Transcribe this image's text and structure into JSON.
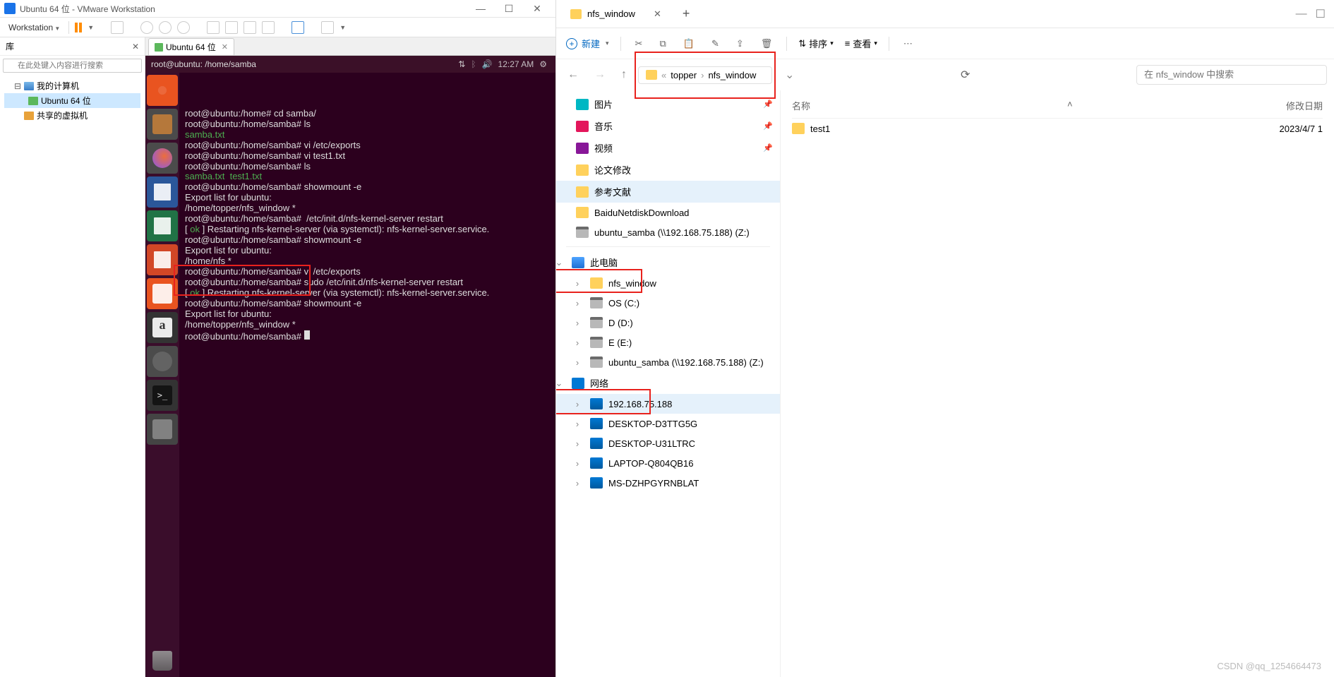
{
  "vmware": {
    "title": "Ubuntu 64 位 - VMware Workstation",
    "menu": "Workstation",
    "library": {
      "title": "库",
      "search_placeholder": "在此处键入内容进行搜索"
    },
    "tree": {
      "my_computer": "我的计算机",
      "ubuntu": "Ubuntu 64 位",
      "shared": "共享的虚拟机"
    },
    "tab": "Ubuntu 64 位"
  },
  "ubuntu": {
    "title": "root@ubuntu: /home/samba",
    "time": "12:27 AM",
    "terminal": [
      {
        "t": "",
        "cls": ""
      },
      {
        "t": "root@ubuntu:/home# cd samba/",
        "cls": ""
      },
      {
        "t": "root@ubuntu:/home/samba# ls",
        "cls": ""
      },
      {
        "t": "samba.txt",
        "cls": "file"
      },
      {
        "t": "root@ubuntu:/home/samba# vi /etc/exports",
        "cls": ""
      },
      {
        "t": "root@ubuntu:/home/samba# vi test1.txt",
        "cls": ""
      },
      {
        "t": "root@ubuntu:/home/samba# ls",
        "cls": ""
      },
      {
        "t": "samba.txt  test1.txt",
        "cls": "file"
      },
      {
        "t": "root@ubuntu:/home/samba# showmount -e",
        "cls": ""
      },
      {
        "t": "Export list for ubuntu:",
        "cls": ""
      },
      {
        "t": "/home/topper/nfs_window *",
        "cls": ""
      },
      {
        "t": "root@ubuntu:/home/samba#  /etc/init.d/nfs-kernel-server restart",
        "cls": ""
      },
      {
        "t": "[ ok ] Restarting nfs-kernel-server (via systemctl): nfs-kernel-server.service.",
        "cls": "ok-line"
      },
      {
        "t": "root@ubuntu:/home/samba# showmount -e",
        "cls": ""
      },
      {
        "t": "Export list for ubuntu:",
        "cls": ""
      },
      {
        "t": "/home/nfs *",
        "cls": ""
      },
      {
        "t": "root@ubuntu:/home/samba# vi /etc/exports",
        "cls": ""
      },
      {
        "t": "root@ubuntu:/home/samba# sudo /etc/init.d/nfs-kernel-server restart",
        "cls": ""
      },
      {
        "t": "[ ok ] Restarting nfs-kernel-server (via systemctl): nfs-kernel-server.service.",
        "cls": "ok-line"
      },
      {
        "t": "root@ubuntu:/home/samba# showmount -e",
        "cls": ""
      },
      {
        "t": "Export list for ubuntu:",
        "cls": ""
      },
      {
        "t": "/home/topper/nfs_window *",
        "cls": ""
      },
      {
        "t": "root@ubuntu:/home/samba# ",
        "cls": "prompt"
      }
    ]
  },
  "explorer": {
    "tab": "nfs_window",
    "new": "新建",
    "sort": "排序",
    "view": "查看",
    "breadcrumb": {
      "chev": "«",
      "p1": "topper",
      "p2": "nfs_window"
    },
    "search_placeholder": "在 nfs_window 中搜索",
    "nav": {
      "pictures": "图片",
      "music": "音乐",
      "video": "视频",
      "paper_edit": "论文修改",
      "references": "参考文献",
      "baidu": "BaiduNetdiskDownload",
      "samba": "ubuntu_samba (\\\\192.168.75.188) (Z:)",
      "this_pc": "此电脑",
      "nfs_window": "nfs_window",
      "os_c": "OS (C:)",
      "d": "D (D:)",
      "e": "E (E:)",
      "samba2": "ubuntu_samba (\\\\192.168.75.188) (Z:)",
      "network": "网络",
      "ip": "192.168.75.188",
      "desk1": "DESKTOP-D3TTG5G",
      "desk2": "DESKTOP-U31LTRC",
      "laptop": "LAPTOP-Q804QB16",
      "ms": "MS-DZHPGYRNBLAT"
    },
    "cols": {
      "name": "名称",
      "modified": "修改日期"
    },
    "rows": [
      {
        "name": "test1",
        "date": "2023/4/7 1"
      }
    ]
  },
  "watermark": "CSDN @qq_1254664473"
}
